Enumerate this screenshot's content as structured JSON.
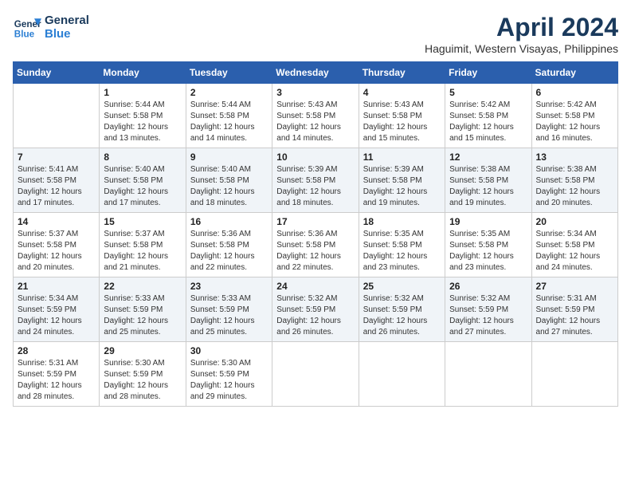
{
  "logo": {
    "line1": "General",
    "line2": "Blue"
  },
  "title": "April 2024",
  "subtitle": "Haguimit, Western Visayas, Philippines",
  "days_of_week": [
    "Sunday",
    "Monday",
    "Tuesday",
    "Wednesday",
    "Thursday",
    "Friday",
    "Saturday"
  ],
  "weeks": [
    [
      {
        "day": "",
        "info": ""
      },
      {
        "day": "1",
        "info": "Sunrise: 5:44 AM\nSunset: 5:58 PM\nDaylight: 12 hours\nand 13 minutes."
      },
      {
        "day": "2",
        "info": "Sunrise: 5:44 AM\nSunset: 5:58 PM\nDaylight: 12 hours\nand 14 minutes."
      },
      {
        "day": "3",
        "info": "Sunrise: 5:43 AM\nSunset: 5:58 PM\nDaylight: 12 hours\nand 14 minutes."
      },
      {
        "day": "4",
        "info": "Sunrise: 5:43 AM\nSunset: 5:58 PM\nDaylight: 12 hours\nand 15 minutes."
      },
      {
        "day": "5",
        "info": "Sunrise: 5:42 AM\nSunset: 5:58 PM\nDaylight: 12 hours\nand 15 minutes."
      },
      {
        "day": "6",
        "info": "Sunrise: 5:42 AM\nSunset: 5:58 PM\nDaylight: 12 hours\nand 16 minutes."
      }
    ],
    [
      {
        "day": "7",
        "info": "Sunrise: 5:41 AM\nSunset: 5:58 PM\nDaylight: 12 hours\nand 17 minutes."
      },
      {
        "day": "8",
        "info": "Sunrise: 5:40 AM\nSunset: 5:58 PM\nDaylight: 12 hours\nand 17 minutes."
      },
      {
        "day": "9",
        "info": "Sunrise: 5:40 AM\nSunset: 5:58 PM\nDaylight: 12 hours\nand 18 minutes."
      },
      {
        "day": "10",
        "info": "Sunrise: 5:39 AM\nSunset: 5:58 PM\nDaylight: 12 hours\nand 18 minutes."
      },
      {
        "day": "11",
        "info": "Sunrise: 5:39 AM\nSunset: 5:58 PM\nDaylight: 12 hours\nand 19 minutes."
      },
      {
        "day": "12",
        "info": "Sunrise: 5:38 AM\nSunset: 5:58 PM\nDaylight: 12 hours\nand 19 minutes."
      },
      {
        "day": "13",
        "info": "Sunrise: 5:38 AM\nSunset: 5:58 PM\nDaylight: 12 hours\nand 20 minutes."
      }
    ],
    [
      {
        "day": "14",
        "info": "Sunrise: 5:37 AM\nSunset: 5:58 PM\nDaylight: 12 hours\nand 20 minutes."
      },
      {
        "day": "15",
        "info": "Sunrise: 5:37 AM\nSunset: 5:58 PM\nDaylight: 12 hours\nand 21 minutes."
      },
      {
        "day": "16",
        "info": "Sunrise: 5:36 AM\nSunset: 5:58 PM\nDaylight: 12 hours\nand 22 minutes."
      },
      {
        "day": "17",
        "info": "Sunrise: 5:36 AM\nSunset: 5:58 PM\nDaylight: 12 hours\nand 22 minutes."
      },
      {
        "day": "18",
        "info": "Sunrise: 5:35 AM\nSunset: 5:58 PM\nDaylight: 12 hours\nand 23 minutes."
      },
      {
        "day": "19",
        "info": "Sunrise: 5:35 AM\nSunset: 5:58 PM\nDaylight: 12 hours\nand 23 minutes."
      },
      {
        "day": "20",
        "info": "Sunrise: 5:34 AM\nSunset: 5:58 PM\nDaylight: 12 hours\nand 24 minutes."
      }
    ],
    [
      {
        "day": "21",
        "info": "Sunrise: 5:34 AM\nSunset: 5:59 PM\nDaylight: 12 hours\nand 24 minutes."
      },
      {
        "day": "22",
        "info": "Sunrise: 5:33 AM\nSunset: 5:59 PM\nDaylight: 12 hours\nand 25 minutes."
      },
      {
        "day": "23",
        "info": "Sunrise: 5:33 AM\nSunset: 5:59 PM\nDaylight: 12 hours\nand 25 minutes."
      },
      {
        "day": "24",
        "info": "Sunrise: 5:32 AM\nSunset: 5:59 PM\nDaylight: 12 hours\nand 26 minutes."
      },
      {
        "day": "25",
        "info": "Sunrise: 5:32 AM\nSunset: 5:59 PM\nDaylight: 12 hours\nand 26 minutes."
      },
      {
        "day": "26",
        "info": "Sunrise: 5:32 AM\nSunset: 5:59 PM\nDaylight: 12 hours\nand 27 minutes."
      },
      {
        "day": "27",
        "info": "Sunrise: 5:31 AM\nSunset: 5:59 PM\nDaylight: 12 hours\nand 27 minutes."
      }
    ],
    [
      {
        "day": "28",
        "info": "Sunrise: 5:31 AM\nSunset: 5:59 PM\nDaylight: 12 hours\nand 28 minutes."
      },
      {
        "day": "29",
        "info": "Sunrise: 5:30 AM\nSunset: 5:59 PM\nDaylight: 12 hours\nand 28 minutes."
      },
      {
        "day": "30",
        "info": "Sunrise: 5:30 AM\nSunset: 5:59 PM\nDaylight: 12 hours\nand 29 minutes."
      },
      {
        "day": "",
        "info": ""
      },
      {
        "day": "",
        "info": ""
      },
      {
        "day": "",
        "info": ""
      },
      {
        "day": "",
        "info": ""
      }
    ]
  ]
}
